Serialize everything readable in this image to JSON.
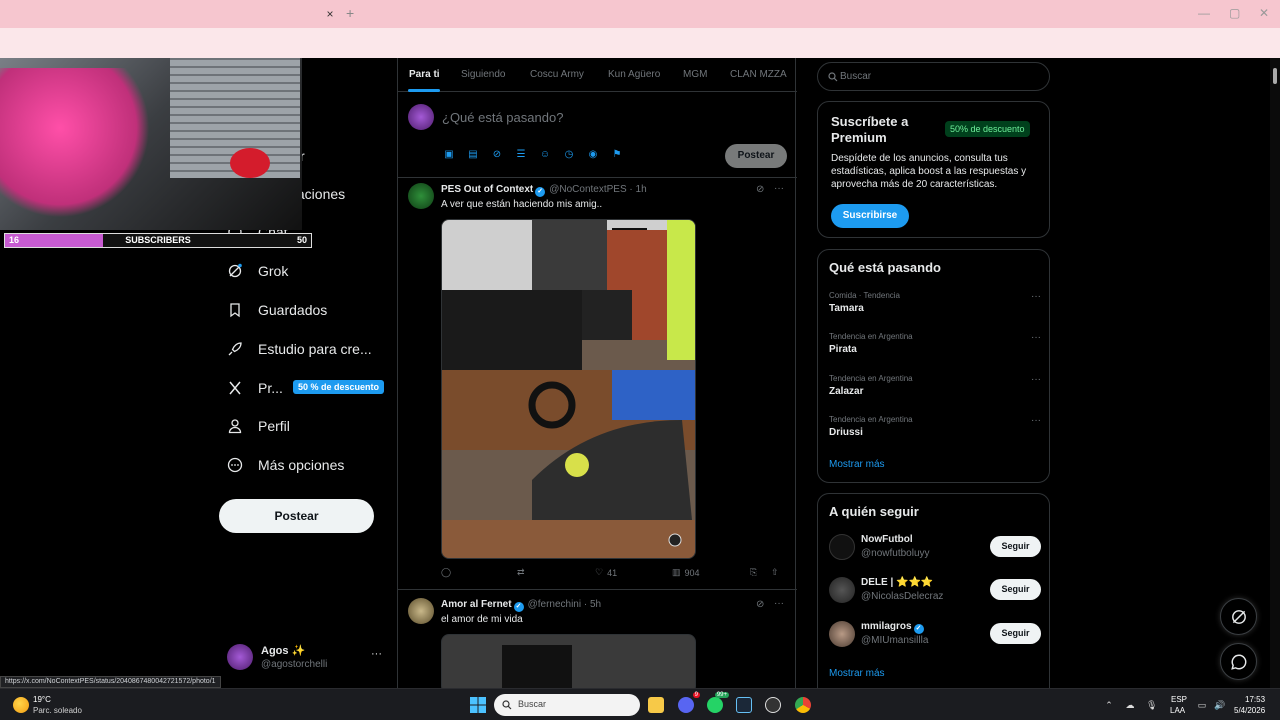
{
  "browser": {
    "tab_close": "×",
    "tab_new": "+",
    "window_controls": [
      "—",
      "▢",
      "✕"
    ]
  },
  "overlay": {
    "subscribers_count": "16",
    "subscribers_label": "SUBSCRIBERS",
    "subscribers_goal": "50",
    "progress_fraction": 0.32
  },
  "nav": {
    "partial_label": "r",
    "items": [
      {
        "label": "Notificaciones",
        "icon": "bell-icon"
      },
      {
        "label": "Chat",
        "icon": "chat-icon"
      },
      {
        "label": "Grok",
        "icon": "grok-icon"
      },
      {
        "label": "Guardados",
        "icon": "bookmark-icon"
      },
      {
        "label": "Estudio para cre...",
        "icon": "rocket-icon"
      },
      {
        "label": "Pr...",
        "icon": "x-logo-icon"
      },
      {
        "label": "Perfil",
        "icon": "person-icon"
      },
      {
        "label": "Más opciones",
        "icon": "more-circle-icon"
      }
    ],
    "premium_badge": "50 % de descuento",
    "post_button": "Postear",
    "account": {
      "name": "Agos ✨",
      "handle": "@agostorchelli",
      "more": "···"
    }
  },
  "feed": {
    "tabs": [
      "Para ti",
      "Siguiendo",
      "Coscu Army",
      "Kun Agüero",
      "MGM",
      "CLAN MZZA"
    ],
    "compose_placeholder": "¿Qué está pasando?",
    "compose_post": "Postear",
    "tweets": [
      {
        "name": "PES Out of Context",
        "meta": "@NoContextPES · 1h",
        "text": "A ver que están haciendo mis amig..",
        "replies": "",
        "retweets": "",
        "likes": "41",
        "views": "904"
      },
      {
        "name": "Amor al Fernet",
        "meta": "@fernechini · 5h",
        "text": "el amor de mi vida"
      }
    ]
  },
  "right": {
    "search_placeholder": "Buscar",
    "premium": {
      "title": "Suscríbete a Premium",
      "badge": "50% de descuento",
      "desc": "Despídete de los anuncios, consulta tus estadísticas, aplica boost a las respuestas y aprovecha más de 20 características.",
      "button": "Suscribirse"
    },
    "trends_title": "Qué está pasando",
    "trends": [
      {
        "category": "Comida · Tendencia",
        "name": "Tamara"
      },
      {
        "category": "Tendencia en Argentina",
        "name": "Pirata"
      },
      {
        "category": "Tendencia en Argentina",
        "name": "Zalazar"
      },
      {
        "category": "Tendencia en Argentina",
        "name": "Driussi"
      }
    ],
    "trends_more": "Mostrar más",
    "who_title": "A quién seguir",
    "who": [
      {
        "name": "NowFutbol",
        "handle": "@nowfutboluyy",
        "button": "Seguir"
      },
      {
        "name": "DELE | ⭐⭐⭐",
        "handle": "@NicolasDelecraz",
        "button": "Seguir"
      },
      {
        "name": "mmilagros",
        "handle": "@MIUmansillla",
        "button": "Seguir"
      }
    ],
    "who_more": "Mostrar más",
    "more_dots": "···"
  },
  "status_url": "https://x.com/NoContextPES/status/2040867480042721572/photo/1",
  "taskbar": {
    "weather_temp": "19°C",
    "weather_desc": "Parc. soleado",
    "search_placeholder": "Buscar",
    "discord_badge": "9",
    "whatsapp_badge": "99+",
    "lang_line1": "ESP",
    "lang_line2": "LAA",
    "time": "17:53",
    "date": "5/4/2026"
  },
  "colors": {
    "accent": "#1d9bf0",
    "background": "#000000",
    "tab_strip": "#f6c6cf",
    "premium_badge_bg": "#00401c"
  }
}
